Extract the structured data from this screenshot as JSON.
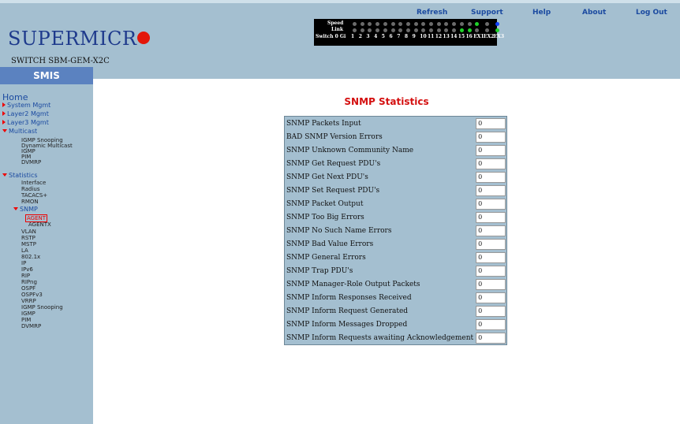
{
  "header": {
    "brand": "SUPERMICR",
    "switch_name": "SWITCH SBM-GEM-X2C",
    "menu_title": "SMIS",
    "links": [
      "Refresh",
      "Support",
      "Help",
      "About",
      "Log Out"
    ]
  },
  "port_panel": {
    "speed_label": "Speed",
    "link_label": "Link",
    "switch_label": "Switch 0 Gi",
    "ports": [
      "1",
      "2",
      "3",
      "4",
      "5",
      "6",
      "7",
      "8",
      "9",
      "10",
      "11",
      "12",
      "13",
      "14",
      "15",
      "16",
      "EX1",
      "EX2",
      "EX3"
    ],
    "colors": {
      "off": "#6b6b6b",
      "green": "#1fd22a",
      "blue": "#1040ff"
    }
  },
  "sidebar": {
    "home": "Home",
    "items": [
      {
        "label": "System Mgmt"
      },
      {
        "label": "Layer2 Mgmt"
      },
      {
        "label": "Layer3 Mgmt"
      },
      {
        "label": "Multicast"
      },
      {
        "label": "IGMP Snooping"
      },
      {
        "label": "Dynamic Multicast"
      },
      {
        "label": "IGMP"
      },
      {
        "label": "PIM"
      },
      {
        "label": "DVMRP"
      },
      {
        "label": "Statistics"
      },
      {
        "label": "Interface"
      },
      {
        "label": "Radius"
      },
      {
        "label": "TACACS+"
      },
      {
        "label": "RMON"
      },
      {
        "label": "SNMP"
      },
      {
        "label": "AGENT"
      },
      {
        "label": "AGENTX"
      },
      {
        "label": "VLAN"
      },
      {
        "label": "RSTP"
      },
      {
        "label": "MSTP"
      },
      {
        "label": "LA"
      },
      {
        "label": "802.1x"
      },
      {
        "label": "IP"
      },
      {
        "label": "IPv6"
      },
      {
        "label": "RIP"
      },
      {
        "label": "RIPng"
      },
      {
        "label": "OSPF"
      },
      {
        "label": "OSPFv3"
      },
      {
        "label": "VRRP"
      },
      {
        "label": "IGMP Snooping"
      },
      {
        "label": "IGMP"
      },
      {
        "label": "PIM"
      },
      {
        "label": "DVMRP"
      }
    ]
  },
  "main": {
    "title": "SNMP Statistics",
    "rows": [
      {
        "label": "SNMP Packets Input",
        "value": "0"
      },
      {
        "label": "BAD SNMP Version Errors",
        "value": "0"
      },
      {
        "label": "SNMP Unknown Community Name",
        "value": "0"
      },
      {
        "label": "SNMP Get Request PDU's",
        "value": "0"
      },
      {
        "label": "SNMP Get Next PDU's",
        "value": "0"
      },
      {
        "label": "SNMP Set Request PDU's",
        "value": "0"
      },
      {
        "label": "SNMP Packet Output",
        "value": "0"
      },
      {
        "label": "SNMP Too Big Errors",
        "value": "0"
      },
      {
        "label": "SNMP No Such Name Errors",
        "value": "0"
      },
      {
        "label": "SNMP Bad Value Errors",
        "value": "0"
      },
      {
        "label": "SNMP General Errors",
        "value": "0"
      },
      {
        "label": "SNMP Trap PDU's",
        "value": "0"
      },
      {
        "label": "SNMP Manager-Role Output Packets",
        "value": "0"
      },
      {
        "label": "SNMP Inform Responses Received",
        "value": "0"
      },
      {
        "label": "SNMP Inform Request Generated",
        "value": "0"
      },
      {
        "label": "SNMP Inform Messages Dropped",
        "value": "0"
      },
      {
        "label": "SNMP Inform Requests awaiting Acknowledgement",
        "value": "0"
      }
    ]
  }
}
